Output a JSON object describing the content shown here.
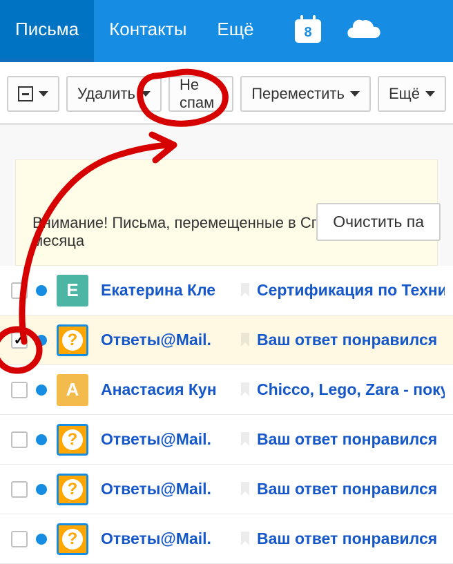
{
  "nav": {
    "tabs": [
      "Письма",
      "Контакты",
      "Ещё"
    ],
    "calendar_badge": "8"
  },
  "toolbar": {
    "delete": "Удалить",
    "not_spam": "Не спам",
    "move": "Переместить",
    "more": "Ещё"
  },
  "notice": {
    "clear_button": "Очистить па",
    "warning": "Внимание! Письма, перемещенные в Спам более месяца"
  },
  "mails": [
    {
      "checked": false,
      "avatar_type": "e",
      "avatar_text": "Е",
      "sender": "Екатерина Кле",
      "subject": "Сертификация по Техни"
    },
    {
      "checked": true,
      "avatar_type": "q",
      "avatar_text": "?",
      "sender": "Ответы@Mail.",
      "subject": "Ваш ответ понравился"
    },
    {
      "checked": false,
      "avatar_type": "a",
      "avatar_text": "А",
      "sender": "Анастасия Кун",
      "subject": "Chicco, Lego, Zara - поку"
    },
    {
      "checked": false,
      "avatar_type": "q",
      "avatar_text": "?",
      "sender": "Ответы@Mail.",
      "subject": "Ваш ответ понравился"
    },
    {
      "checked": false,
      "avatar_type": "q",
      "avatar_text": "?",
      "sender": "Ответы@Mail.",
      "subject": "Ваш ответ понравился"
    },
    {
      "checked": false,
      "avatar_type": "q",
      "avatar_text": "?",
      "sender": "Ответы@Mail.",
      "subject": "Ваш ответ понравился"
    }
  ]
}
